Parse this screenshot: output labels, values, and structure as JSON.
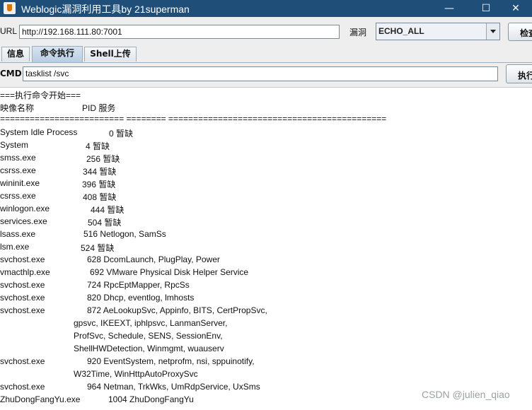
{
  "window": {
    "title": "Weblogic漏洞利用工具by 21superman",
    "min_glyph": "—",
    "max_glyph": "☐",
    "close_glyph": "✕",
    "app_icon": "java-icon"
  },
  "toolbar": {
    "url_label": "URL",
    "url_value": "http://192.168.111.80:7001",
    "vuln_label": "漏洞",
    "vuln_selected": "ECHO_ALL",
    "check_button": "检查"
  },
  "tabs": [
    {
      "label": "信息",
      "active": false
    },
    {
      "label": "命令执行",
      "active": true
    },
    {
      "label": "Shell上传",
      "active": false
    }
  ],
  "cmd": {
    "label": "CMD",
    "value": "tasklist /svc",
    "exec_button": "执行"
  },
  "output": {
    "start_line": "===执行命令开始===",
    "header": {
      "image": "映像名称",
      "pid_services": "PID 服务"
    },
    "separator": "========================= ======== ============================================",
    "rows": [
      {
        "name": "System Idle Process",
        "pid_svc": "0 暂缺"
      },
      {
        "name": "System",
        "pid_svc": "4 暂缺"
      },
      {
        "name": "smss.exe",
        "pid_svc": "256 暂缺"
      },
      {
        "name": "csrss.exe",
        "pid_svc": "344 暂缺"
      },
      {
        "name": "wininit.exe",
        "pid_svc": "396 暂缺"
      },
      {
        "name": "csrss.exe",
        "pid_svc": "408 暂缺"
      },
      {
        "name": "winlogon.exe",
        "pid_svc": "444 暂缺"
      },
      {
        "name": "services.exe",
        "pid_svc": "504 暂缺"
      },
      {
        "name": "lsass.exe",
        "pid_svc": "516 Netlogon, SamSs"
      },
      {
        "name": "lsm.exe",
        "pid_svc": "524 暂缺"
      },
      {
        "name": "svchost.exe",
        "pid_svc": "628 DcomLaunch, PlugPlay, Power"
      },
      {
        "name": "vmacthlp.exe",
        "pid_svc": "692 VMware Physical Disk Helper Service"
      },
      {
        "name": "svchost.exe",
        "pid_svc": "724 RpcEptMapper, RpcSs"
      },
      {
        "name": "svchost.exe",
        "pid_svc": "820 Dhcp, eventlog, lmhosts"
      },
      {
        "name": "svchost.exe",
        "pid_svc": "872 AeLookupSvc, Appinfo, BITS, CertPropSvc,"
      },
      {
        "name": "",
        "pid_svc": "gpsvc, IKEEXT, iphlpsvc, LanmanServer,"
      },
      {
        "name": "",
        "pid_svc": "ProfSvc, Schedule, SENS, SessionEnv,"
      },
      {
        "name": "",
        "pid_svc": "ShellHWDetection, Winmgmt, wuauserv"
      },
      {
        "name": "svchost.exe",
        "pid_svc": "920 EventSystem, netprofm, nsi, sppuinotify,"
      },
      {
        "name": "",
        "pid_svc": "W32Time, WinHttpAutoProxySvc"
      },
      {
        "name": "svchost.exe",
        "pid_svc": "964 Netman, TrkWks, UmRdpService, UxSms"
      },
      {
        "name": "ZhuDongFangYu.exe",
        "pid_svc": "1004 ZhuDongFangYu"
      }
    ]
  },
  "watermark": "CSDN @julien_qiao"
}
